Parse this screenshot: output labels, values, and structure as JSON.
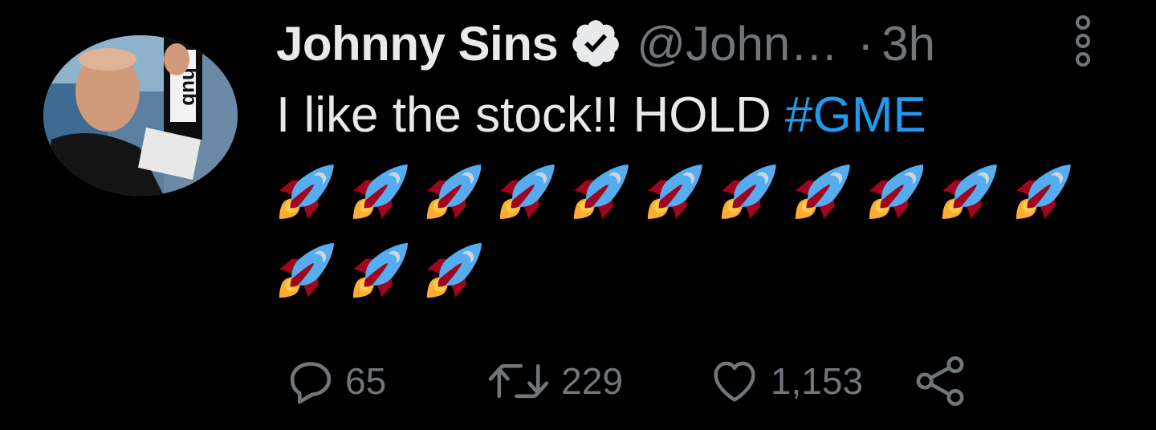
{
  "tweet": {
    "display_name": "Johnny Sins",
    "handle": "@John…",
    "separator": "·",
    "time": "3h",
    "text_plain": "I like the stock!! HOLD ",
    "hashtag": "#GME",
    "rocket_count": 14,
    "avatar_sign_text": "hub"
  },
  "actions": {
    "replies": "65",
    "retweets": "229",
    "likes": "1,153"
  },
  "icons": {
    "verified": "verified-badge-icon",
    "more": "more-options-icon",
    "reply": "reply-icon",
    "retweet": "retweet-icon",
    "like": "heart-icon",
    "share": "share-icon",
    "rocket": "rocket-emoji-icon"
  },
  "colors": {
    "background": "#000000",
    "text": "#e7e9ea",
    "muted": "#71767b",
    "link": "#1d9bf0"
  }
}
